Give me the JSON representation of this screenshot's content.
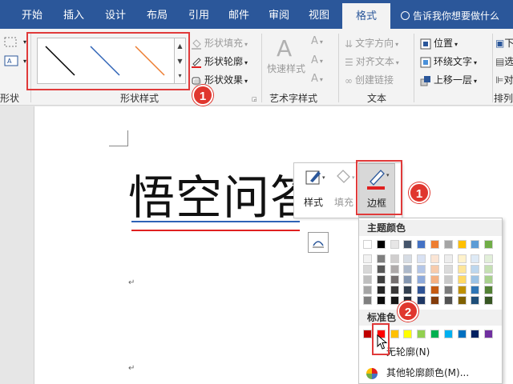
{
  "tabs": [
    {
      "key": "home",
      "label": "开始"
    },
    {
      "key": "insert",
      "label": "插入"
    },
    {
      "key": "design",
      "label": "设计"
    },
    {
      "key": "layout",
      "label": "布局"
    },
    {
      "key": "references",
      "label": "引用"
    },
    {
      "key": "mailings",
      "label": "邮件"
    },
    {
      "key": "review",
      "label": "审阅"
    },
    {
      "key": "view",
      "label": "视图"
    },
    {
      "key": "format",
      "label": "格式",
      "active": true
    }
  ],
  "tell_me": "告诉我你想要做什么",
  "ribbon": {
    "shapes_group": "形状",
    "shape_styles_group": "形状样式",
    "gallery_line_colors": [
      "#000000",
      "#2e63b6",
      "#ed7d31"
    ],
    "shape_fill": "形状填充",
    "shape_outline": "形状轮廓",
    "shape_effects": "形状效果",
    "quick_styles": "快速样式",
    "wordart_group": "艺术字样式",
    "text_direction": "文字方向",
    "align_text": "对齐文本",
    "create_link": "创建链接",
    "text_group": "文本",
    "position": "位置",
    "wrap_text": "环绕文字",
    "bring_forward": "上移一层",
    "send_backward_partial": "下",
    "selection_pane_partial": "选",
    "align_partial": "对",
    "arrange_group": "排列"
  },
  "document": {
    "heading": "悟空问答",
    "para_mark": "↵",
    "line_colors": {
      "top": "#2e63b6",
      "bottom": "#e02020"
    }
  },
  "mini_toolbar": {
    "style_label": "样式",
    "fill_label": "填充",
    "outline_label": "边框"
  },
  "color_menu": {
    "theme_colors_title": "主题颜色",
    "standard_colors_title": "标准色",
    "no_outline": "无轮廓(N)",
    "more_colors": "其他轮廓颜色(M)...",
    "theme_top_row": [
      "#ffffff",
      "#000000",
      "#e7e6e6",
      "#44546a",
      "#4472c4",
      "#ed7d31",
      "#a5a5a5",
      "#ffc000",
      "#5b9bd5",
      "#70ad47"
    ],
    "theme_shades": [
      [
        "#f2f2f2",
        "#7f7f7f",
        "#d0cece",
        "#d6dce4",
        "#d9e2f3",
        "#fbe5d5",
        "#ededed",
        "#fff2cc",
        "#deeaf6",
        "#e2efd9"
      ],
      [
        "#d8d8d8",
        "#595959",
        "#aeaaaa",
        "#adb9ca",
        "#b4c6e7",
        "#f7cbac",
        "#dbdbdb",
        "#fee599",
        "#bdd7ee",
        "#c5e0b3"
      ],
      [
        "#bfbfbf",
        "#3f3f3f",
        "#757070",
        "#8496b0",
        "#8eaadb",
        "#f4b183",
        "#c9c9c9",
        "#ffd965",
        "#9cc3e5",
        "#a8d08d"
      ],
      [
        "#a5a5a5",
        "#262626",
        "#3a3838",
        "#323f4f",
        "#2f5496",
        "#c55a11",
        "#7b7b7b",
        "#bf9000",
        "#2e75b5",
        "#538135"
      ],
      [
        "#7f7f7f",
        "#0c0c0c",
        "#171616",
        "#222a35",
        "#1f3864",
        "#833c0b",
        "#525252",
        "#7f6000",
        "#1e4e79",
        "#375623"
      ]
    ],
    "standard": [
      "#c00000",
      "#ff0000",
      "#ffc000",
      "#ffff00",
      "#92d050",
      "#00b050",
      "#00b0f0",
      "#0070c0",
      "#002060",
      "#7030a0"
    ]
  },
  "annotations": {
    "badge_one": "1",
    "badge_two": "2"
  }
}
